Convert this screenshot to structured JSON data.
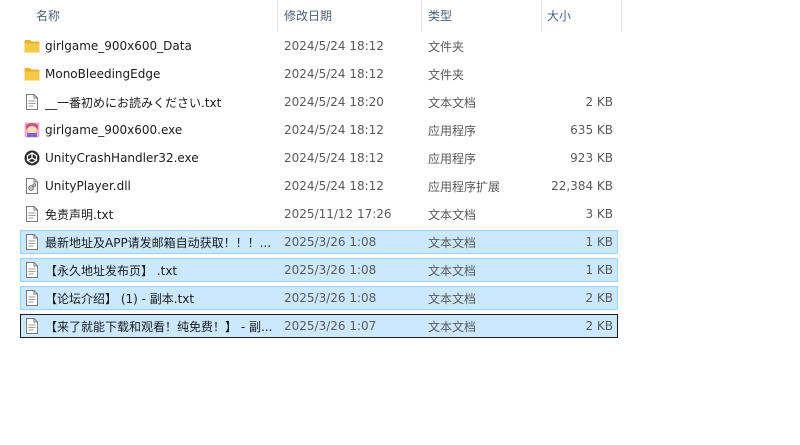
{
  "header": {
    "name": "名称",
    "date": "修改日期",
    "type": "类型",
    "size": "大小",
    "sort_arrow": "^"
  },
  "colors": {
    "selected_bg": "#cce8ff",
    "selected_border": "#99d1ff",
    "folder": "#f7c948"
  },
  "files": [
    {
      "name": "girlgame_900x600_Data",
      "date": "2024/5/24 18:12",
      "type": "文件夹",
      "size": "",
      "icon": "folder-icon",
      "selected": false,
      "focused": false
    },
    {
      "name": "MonoBleedingEdge",
      "date": "2024/5/24 18:12",
      "type": "文件夹",
      "size": "",
      "icon": "folder-icon",
      "selected": false,
      "focused": false
    },
    {
      "name": "__一番初めにお読みください.txt",
      "date": "2024/5/24 18:20",
      "type": "文本文档",
      "size": "2 KB",
      "icon": "text-file-icon",
      "selected": false,
      "focused": false
    },
    {
      "name": "girlgame_900x600.exe",
      "date": "2024/5/24 18:12",
      "type": "应用程序",
      "size": "635 KB",
      "icon": "game-app-icon",
      "selected": false,
      "focused": false
    },
    {
      "name": "UnityCrashHandler32.exe",
      "date": "2024/5/24 18:12",
      "type": "应用程序",
      "size": "923 KB",
      "icon": "unity-icon",
      "selected": false,
      "focused": false
    },
    {
      "name": "UnityPlayer.dll",
      "date": "2024/5/24 18:12",
      "type": "应用程序扩展",
      "size": "22,384 KB",
      "icon": "dll-file-icon",
      "selected": false,
      "focused": false
    },
    {
      "name": "免责声明.txt",
      "date": "2025/11/12 17:26",
      "type": "文本文档",
      "size": "3 KB",
      "icon": "text-file-icon",
      "selected": false,
      "focused": false
    },
    {
      "name": "最新地址及APP请发邮箱自动获取！！！...",
      "date": "2025/3/26 1:08",
      "type": "文本文档",
      "size": "1 KB",
      "icon": "text-file-icon",
      "selected": true,
      "focused": false
    },
    {
      "name": "【永久地址发布页】 .txt",
      "date": "2025/3/26 1:08",
      "type": "文本文档",
      "size": "1 KB",
      "icon": "text-file-icon",
      "selected": true,
      "focused": false
    },
    {
      "name": "【论坛介绍】 (1) - 副本.txt",
      "date": "2025/3/26 1:08",
      "type": "文本文档",
      "size": "2 KB",
      "icon": "text-file-icon",
      "selected": true,
      "focused": false
    },
    {
      "name": "【来了就能下载和观看！纯免费！】 - 副...",
      "date": "2025/3/26 1:07",
      "type": "文本文档",
      "size": "2 KB",
      "icon": "text-file-icon",
      "selected": true,
      "focused": true
    }
  ]
}
